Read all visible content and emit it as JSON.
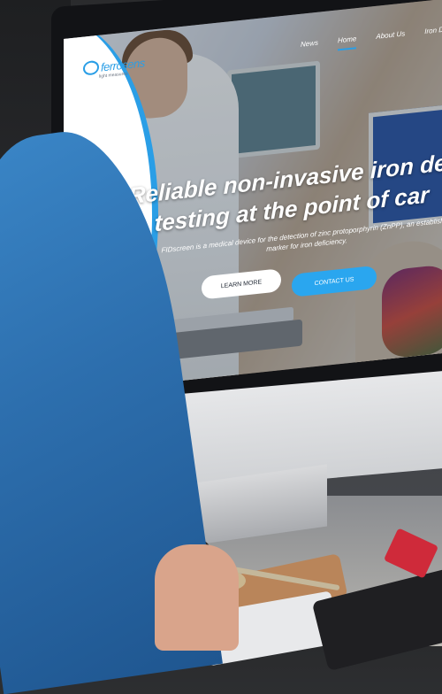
{
  "brand": {
    "name": "ferrosens",
    "tagline": "light measures"
  },
  "nav": {
    "items": [
      "News",
      "Home",
      "About Us",
      "Iron Deficien"
    ],
    "active": "Home"
  },
  "hero": {
    "title_line1": "Reliable non-invasive iron def",
    "title_line2": "testing at the point of car",
    "subtitle": "FIDscreen is a medical device for the detection of zinc protoporphyrin (ZnPP), an established marker for iron deficiency."
  },
  "buttons": {
    "learn_more": "LEARN MORE",
    "contact_us": "CONTACT US"
  },
  "colors": {
    "accent": "#2aa6ef",
    "white": "#ffffff"
  }
}
